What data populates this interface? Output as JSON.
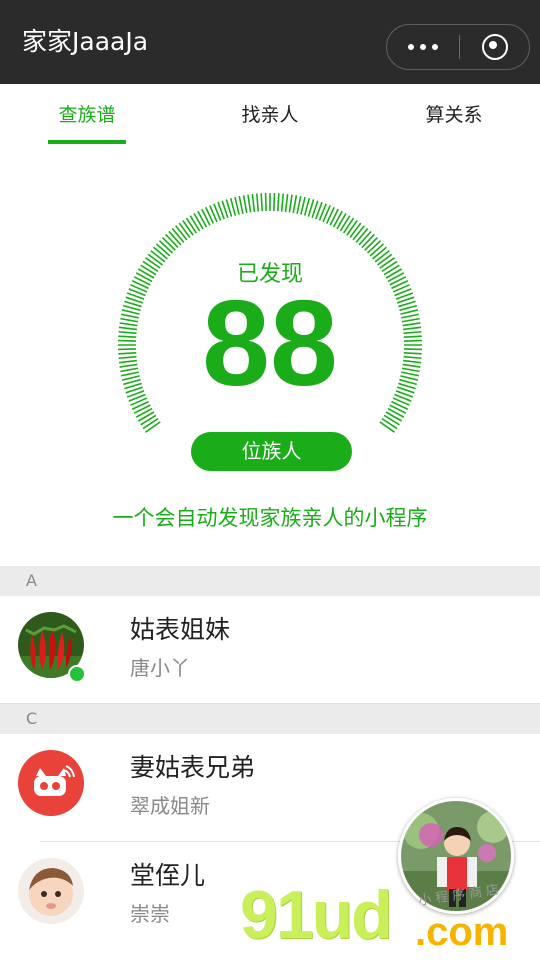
{
  "titlebar": {
    "title": "家家JaaaJa"
  },
  "tabs": [
    {
      "label": "查族谱",
      "active": true
    },
    {
      "label": "找亲人",
      "active": false
    },
    {
      "label": "算关系",
      "active": false
    }
  ],
  "summary": {
    "found_label": "已发现",
    "count": "88",
    "unit_button": "位族人",
    "slogan": "一个会自动发现家族亲人的小程序"
  },
  "sections": [
    {
      "letter": "A",
      "items": [
        {
          "name": "姑表姐妹",
          "sub": "唐小丫",
          "avatar": "chili-pepper-photo",
          "online": true
        }
      ]
    },
    {
      "letter": "C",
      "items": [
        {
          "name": "妻姑表兄弟",
          "sub": "翠成姐新",
          "avatar": "red-pig-logo",
          "online": false
        },
        {
          "name": "堂侄儿",
          "sub": "崇崇",
          "avatar": "baby-photo",
          "online": false
        }
      ]
    }
  ],
  "watermark": {
    "brand": "91ud",
    "tld": ".com",
    "tagline": "小程序商店"
  },
  "colors": {
    "accent": "#1aad19",
    "titlebar": "#2b2b2b",
    "section_bg": "#ebebeb"
  },
  "icons": {
    "more": "more-dots-icon",
    "close": "target-close-icon"
  }
}
